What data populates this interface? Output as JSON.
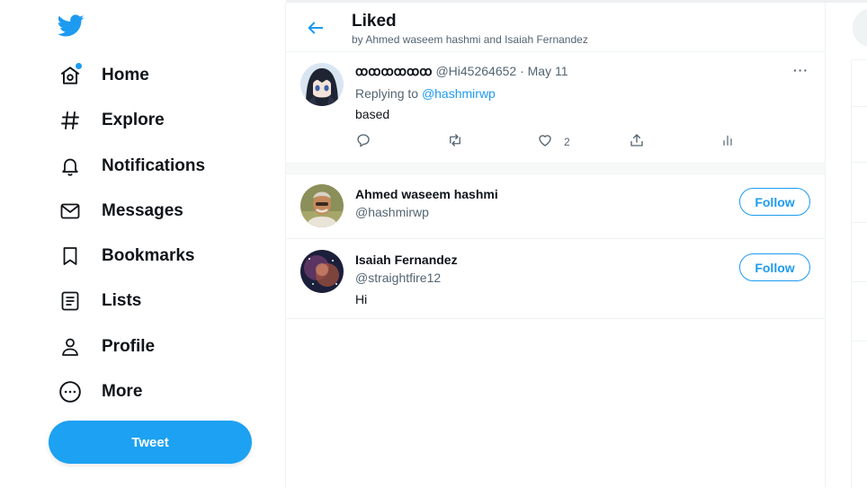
{
  "nav": {
    "items": [
      {
        "label": "Home",
        "icon": "home-icon"
      },
      {
        "label": "Explore",
        "icon": "hashtag-icon"
      },
      {
        "label": "Notifications",
        "icon": "bell-icon"
      },
      {
        "label": "Messages",
        "icon": "envelope-icon"
      },
      {
        "label": "Bookmarks",
        "icon": "bookmark-icon"
      },
      {
        "label": "Lists",
        "icon": "list-icon"
      },
      {
        "label": "Profile",
        "icon": "person-icon"
      },
      {
        "label": "More",
        "icon": "more-circle-icon"
      }
    ],
    "tweet_button": "Tweet"
  },
  "header": {
    "title": "Liked",
    "subtitle": "by Ahmed waseem hashmi and Isaiah Fernandez"
  },
  "tweet": {
    "author_name": "ꝏꝏꝏꝏꝏꝏ",
    "meta": "@Hi45264652 · May 11",
    "replying_prefix": "Replying to",
    "replying_handle": "@hashmirwp",
    "text": "based",
    "like_count": "2",
    "more": "···"
  },
  "users": [
    {
      "name": "Ahmed waseem hashmi",
      "handle": "@hashmirwp",
      "bio": "",
      "follow_label": "Follow"
    },
    {
      "name": "Isaiah Fernandez",
      "handle": "@straightfire12",
      "bio": "Hi",
      "follow_label": "Follow"
    }
  ],
  "colors": {
    "accent": "#1d9bf0",
    "tweet_button": "#1da1f2",
    "text_primary": "#0f1419",
    "text_secondary": "#536471",
    "border": "#eff3f4"
  }
}
